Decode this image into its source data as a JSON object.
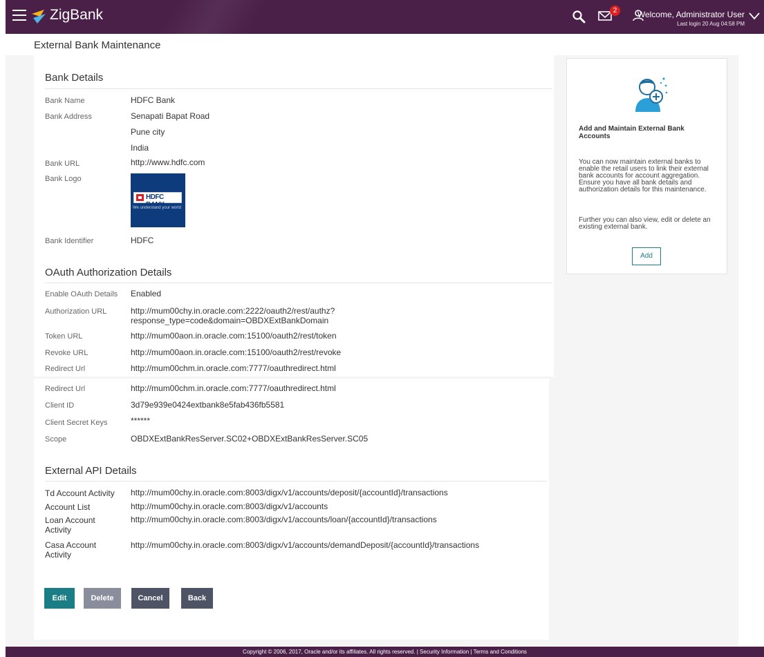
{
  "header": {
    "brand": "ZigBank",
    "notification_count": "2",
    "welcome": "Welcome, Administrator User",
    "last_login": "Last login 20 Aug 04:58 PM",
    "colors": {
      "bar": "#4a1f48",
      "badge": "#e02020"
    }
  },
  "page": {
    "title": "External Bank Maintenance"
  },
  "bank_details": {
    "title": "Bank Details",
    "bank_name_label": "Bank Name",
    "bank_name": "HDFC Bank",
    "bank_address_label": "Bank Address",
    "address_line1": "Senapati Bapat Road",
    "address_line2": "Pune city",
    "address_line3": "India",
    "bank_url_label": "Bank URL",
    "bank_url": "http://www.hdfc.com",
    "bank_logo_label": "Bank Logo",
    "logo_text": "HDFC BANK",
    "logo_tagline": "We understand your world",
    "bank_identifier_label": "Bank Identifier",
    "bank_identifier": "HDFC"
  },
  "oauth": {
    "title": "OAuth Authorization Details",
    "enable_label": "Enable OAuth Details",
    "enable_value": "Enabled",
    "auth_url_label": "Authorization URL",
    "auth_url_line1": "http://mum00chy.in.oracle.com:2222/oauth2/rest/authz?",
    "auth_url_line2": "response_type=code&domain=OBDXExtBankDomain",
    "token_url_label": "Token URL",
    "token_url": "http://mum00aon.in.oracle.com:15100/oauth2/rest/token",
    "revoke_url_label": "Revoke URL",
    "revoke_url": "http://mum00aon.in.oracle.com:15100/oauth2/rest/revoke",
    "redirect_url_label": "Redirect Url",
    "redirect_url": "http://mum00chm.in.oracle.com:7777/oauthredirect.html",
    "redirect_url_label_2": "Redirect Url",
    "redirect_url_2": "http://mum00chm.in.oracle.com:7777/oauthredirect.html",
    "client_id_label": "Client ID",
    "client_id": "3d79e939e0424extbank8e5fab436fb5581",
    "client_secret_label": "Client Secret Keys",
    "client_secret": "******",
    "scope_label": "Scope",
    "scope": "OBDXExtBankResServer.SC02+OBDXExtBankResServer.SC05"
  },
  "external_api": {
    "title": "External API Details",
    "td_label": "Td Account Activity",
    "td_url": "http://mum00chy.in.oracle.com:8003/digx/v1/accounts/deposit/{accountId}/transactions",
    "account_list_label": "Account List",
    "account_list_url": "http://mum00chy.in.oracle.com:8003/digx/v1/accounts",
    "loan_label_line1": "Loan Account",
    "loan_label_line2": "Activity",
    "loan_url": "http://mum00chy.in.oracle.com:8003/digx/v1/accounts/loan/{accountId}/transactions",
    "casa_label_line1": "Casa Account",
    "casa_label_line2": "Activity",
    "casa_url": "http://mum00chy.in.oracle.com:8003/digx/v1/accounts/demandDeposit/{accountId}/transactions"
  },
  "side_card": {
    "title": "Add and Maintain External Bank Accounts",
    "text1": "You can now maintain external banks to enable the retail users to link their external bank accounts for account aggregation. Ensure you have all bank details and authorization details for this maintenance.",
    "text2": "Further you can also view, edit or delete an existing external bank.",
    "add_label": "Add",
    "accent": "#1b7d86"
  },
  "actions": {
    "edit": "Edit",
    "delete": "Delete",
    "cancel": "Cancel",
    "back": "Back"
  },
  "footer": {
    "copyright": "Copyright © 2006, 2017, Oracle and/or its affiliates. All rights reserved.",
    "sep": "|",
    "security": "Security Information",
    "terms": "Terms and Conditions"
  }
}
